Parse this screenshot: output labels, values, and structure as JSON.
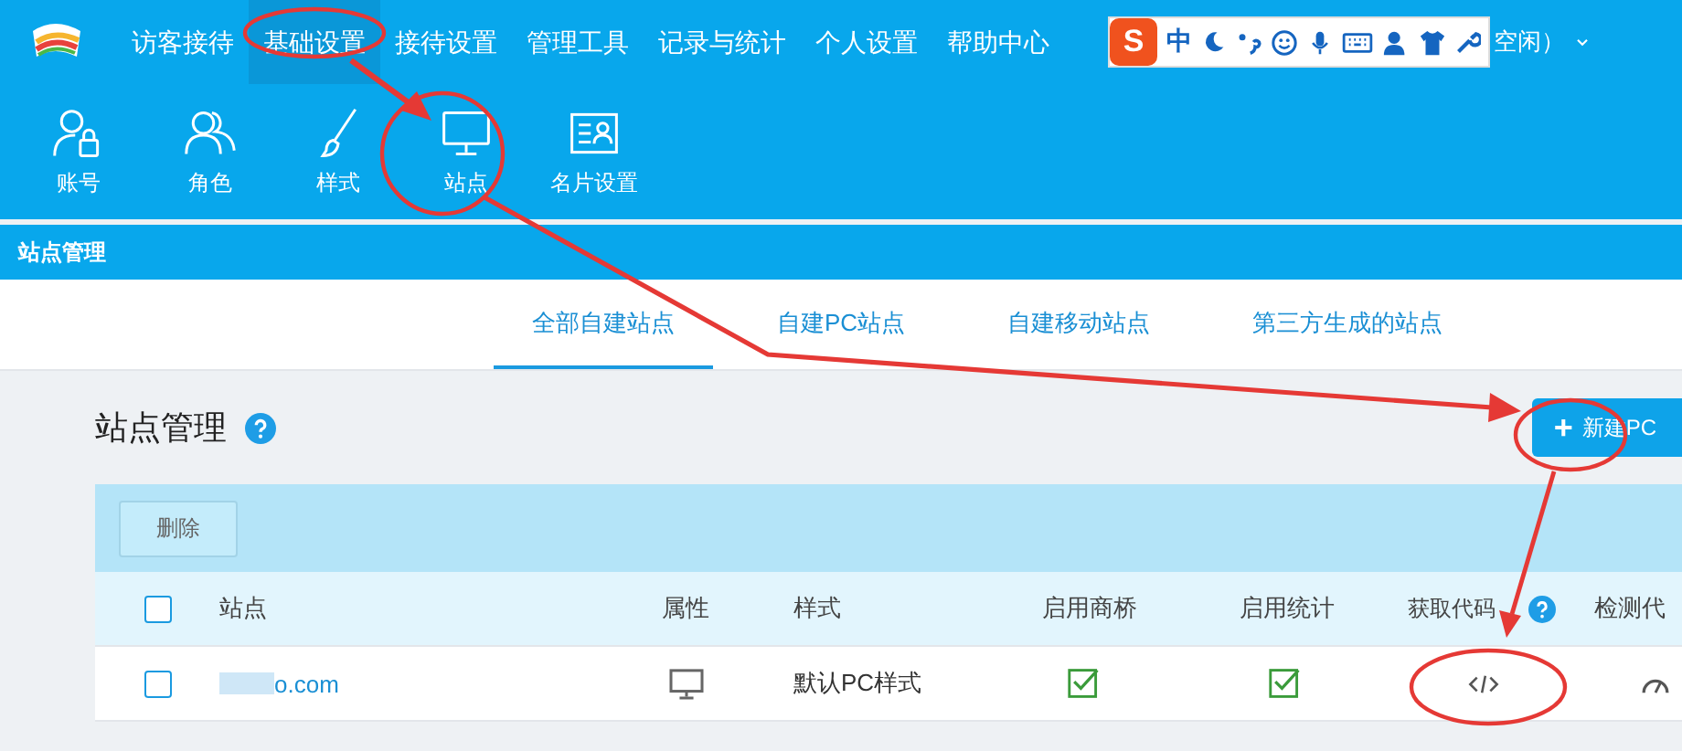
{
  "top_nav": {
    "items": [
      {
        "label": "访客接待",
        "selected": false
      },
      {
        "label": "基础设置",
        "selected": true
      },
      {
        "label": "接待设置",
        "selected": false
      },
      {
        "label": "管理工具",
        "selected": false
      },
      {
        "label": "记录与统计",
        "selected": false
      },
      {
        "label": "个人设置",
        "selected": false
      },
      {
        "label": "帮助中心",
        "selected": false
      }
    ],
    "ime_toolbar": {
      "logo": "S",
      "mode": "中"
    },
    "status": "空闲）"
  },
  "sub_nav": [
    {
      "label": "账号"
    },
    {
      "label": "角色"
    },
    {
      "label": "样式"
    },
    {
      "label": "站点"
    },
    {
      "label": "名片设置"
    }
  ],
  "section_bar": "站点管理",
  "tabs": [
    {
      "label": "全部自建站点",
      "selected": true
    },
    {
      "label": "自建PC站点",
      "selected": false
    },
    {
      "label": "自建移动站点",
      "selected": false
    },
    {
      "label": "第三方生成的站点",
      "selected": false
    }
  ],
  "page_title": "站点管理",
  "new_button": {
    "icon": "+",
    "label": "新建PC"
  },
  "toolbar": {
    "delete_button": "删除"
  },
  "table": {
    "columns": [
      "站点",
      "属性",
      "样式",
      "启用商桥",
      "启用统计",
      "获取代码",
      "检测代"
    ],
    "select_all": {
      "checked": false
    },
    "rows": [
      {
        "checked": false,
        "site": "o.com",
        "style": "默认PC样式",
        "bridge_enabled": true,
        "stats_enabled": true
      }
    ]
  }
}
